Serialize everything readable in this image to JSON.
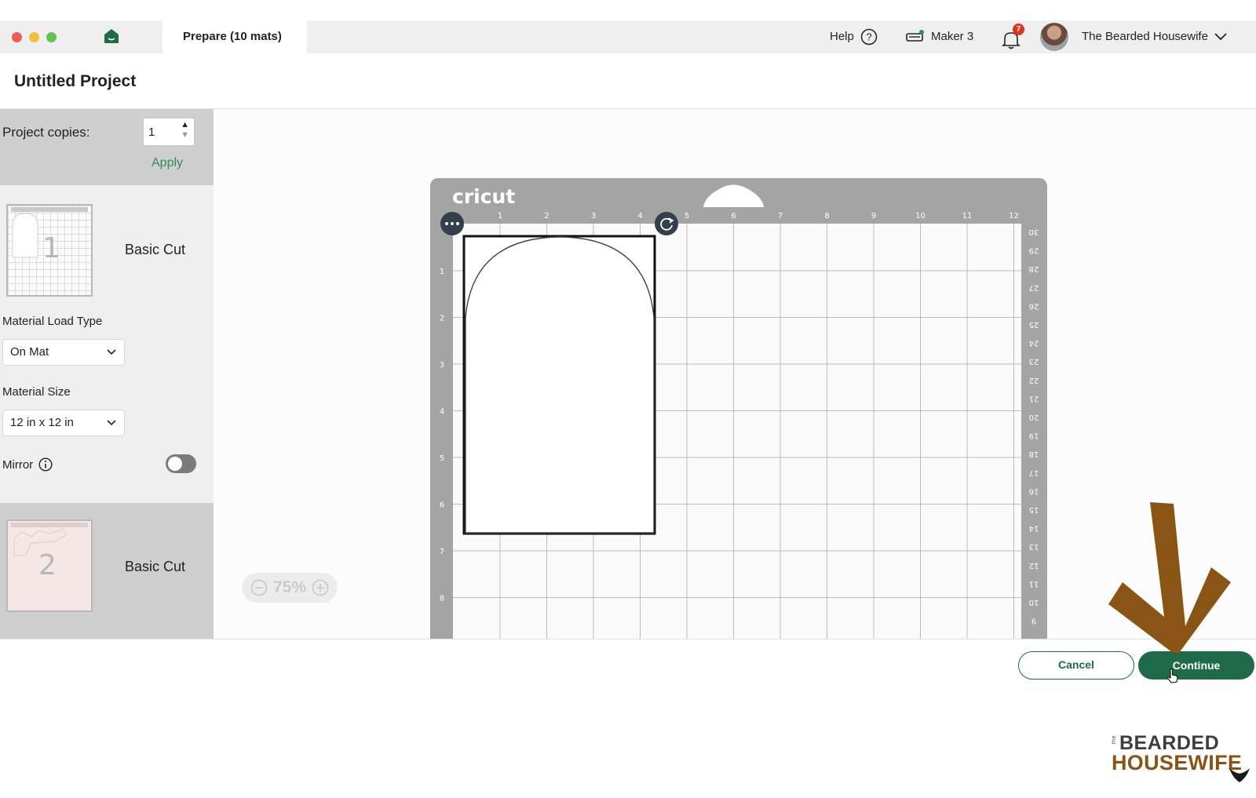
{
  "topbar": {
    "tab_label": "Prepare (10 mats)",
    "help_label": "Help",
    "machine_label": "Maker 3",
    "notification_count": "7",
    "user_name": "The Bearded Housewife"
  },
  "project": {
    "title": "Untitled Project"
  },
  "sidebar": {
    "copies_label": "Project copies:",
    "copies_value": "1",
    "apply_label": "Apply",
    "mats": [
      {
        "number": "1",
        "label": "Basic Cut"
      },
      {
        "number": "2",
        "label": "Basic Cut"
      }
    ],
    "material_load_type_label": "Material Load Type",
    "material_load_type_value": "On Mat",
    "material_size_label": "Material Size",
    "material_size_value": "12 in x 12 in",
    "mirror_label": "Mirror",
    "mirror_on": false
  },
  "mat": {
    "brand": "cricut",
    "top_ruler": [
      "1",
      "2",
      "3",
      "4",
      "5",
      "6",
      "7",
      "8",
      "9",
      "10",
      "11",
      "12"
    ],
    "left_ruler": [
      "1",
      "2",
      "3",
      "4",
      "5",
      "6",
      "7",
      "8"
    ],
    "right_ruler": [
      "30",
      "29",
      "28",
      "27",
      "26",
      "25",
      "24",
      "23",
      "22",
      "21",
      "20",
      "19",
      "18",
      "17",
      "16",
      "15",
      "14",
      "13",
      "12",
      "11",
      "10",
      "9"
    ]
  },
  "zoom": {
    "level": "75%"
  },
  "footer": {
    "cancel_label": "Cancel",
    "continue_label": "Continue"
  },
  "watermark": {
    "small": "the",
    "line1": "BEARDED",
    "line2": "HOUSEWIFE"
  },
  "colors": {
    "accent_green": "#1f6a47",
    "link_green": "#2f8b5b",
    "arrow_brown": "#8a5514",
    "badge_red": "#e0321d"
  }
}
